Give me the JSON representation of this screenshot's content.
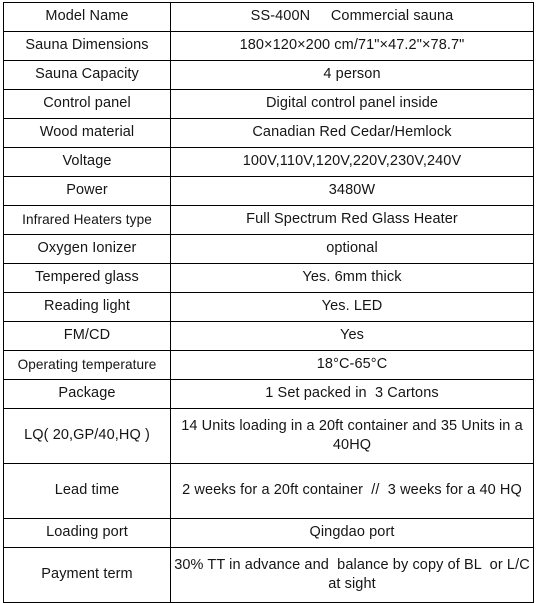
{
  "document": {
    "type": "specification-table",
    "columns": 2,
    "row_count": 17,
    "border_color": "#000000",
    "text_color": "#151515",
    "background_color": "#ffffff"
  },
  "table": {
    "rows": [
      {
        "label": "Model Name",
        "value": "SS-400N     Commercial sauna",
        "lines": 1
      },
      {
        "label": "Sauna Dimensions",
        "value": "180×120×200 cm/71\"×47.2\"×78.7\"",
        "lines": 1
      },
      {
        "label": "Sauna Capacity",
        "value": "4 person",
        "lines": 1
      },
      {
        "label": "Control panel",
        "value": "Digital control panel inside",
        "lines": 1
      },
      {
        "label": "Wood material",
        "value": "Canadian Red Cedar/Hemlock",
        "lines": 1
      },
      {
        "label": "Voltage",
        "value": "100V,110V,120V,220V,230V,240V",
        "lines": 1
      },
      {
        "label": "Power",
        "value": "3480W",
        "lines": 1
      },
      {
        "label": "Infrared Heaters type",
        "value": "Full Spectrum Red Glass Heater",
        "lines": 1
      },
      {
        "label": "Oxygen Ionizer",
        "value": "optional",
        "lines": 1
      },
      {
        "label": "Tempered glass",
        "value": "Yes. 6mm thick",
        "lines": 1
      },
      {
        "label": "Reading light",
        "value": "Yes. LED",
        "lines": 1
      },
      {
        "label": "FM/CD",
        "value": "Yes",
        "lines": 1
      },
      {
        "label": "Operating temperature",
        "value": "18°C-65°C",
        "lines": 1
      },
      {
        "label": "Package",
        "value": "1 Set packed in  3 Cartons",
        "lines": 1
      },
      {
        "label": "LQ( 20,GP/40,HQ )",
        "value": "14 Units loading in a 20ft container and 35 Units in a 40HQ",
        "lines": 2
      },
      {
        "label": "Lead time",
        "value": "2 weeks for a 20ft container  //  3 weeks for a 40 HQ",
        "lines": 2
      },
      {
        "label": "Loading port",
        "value": "Qingdao port",
        "lines": 1
      },
      {
        "label": "Payment term",
        "value": "30% TT in advance and  balance by copy of BL  or L/C at sight",
        "lines": 2
      }
    ]
  }
}
